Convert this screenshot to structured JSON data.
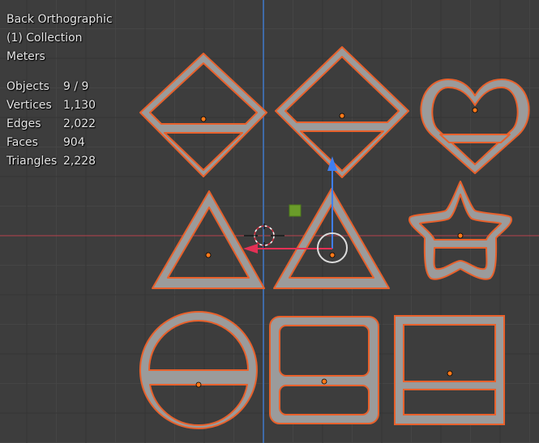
{
  "viewport": {
    "view_name": "Back Orthographic",
    "collection": "(1) Collection",
    "units": "Meters"
  },
  "stats": [
    {
      "label": "Objects",
      "value": "9 / 9"
    },
    {
      "label": "Vertices",
      "value": "1,130"
    },
    {
      "label": "Edges",
      "value": "2,022"
    },
    {
      "label": "Faces",
      "value": "904"
    },
    {
      "label": "Triangles",
      "value": "2,228"
    }
  ],
  "shapes": [
    "diamond-frame-object",
    "diamond-frame-object",
    "heart-frame-object",
    "triangle-frame-object",
    "triangle-frame-object",
    "star-frame-object",
    "circle-frame-object",
    "rounded-rectangle-frame-object",
    "rectangle-frame-object"
  ],
  "colors": {
    "background": "#3d3d3d",
    "grid": "#454545",
    "grid_major": "#353535",
    "x_axis": "#b8434d",
    "z_axis": "#3f6aa8",
    "object_fill": "#9b9b9b",
    "selection_outline": "#e8612c",
    "origin_dot": "#ff7a1a",
    "gizmo_z": "#3f7ef0",
    "gizmo_x": "#e43055",
    "gizmo_green": "#6a9c2a",
    "cursor": "#ffffff"
  }
}
